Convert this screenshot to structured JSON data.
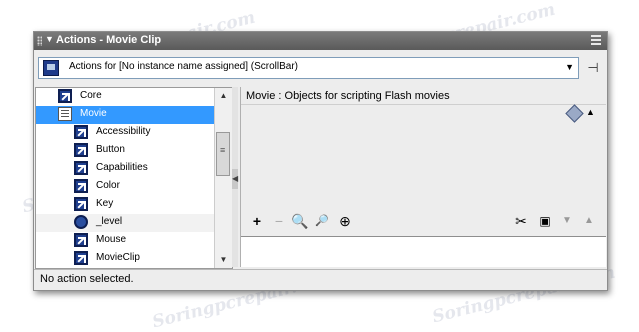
{
  "panel": {
    "title": "Actions - Movie Clip"
  },
  "target": {
    "text": "Actions for [No instance name assigned]  (ScrollBar)"
  },
  "toolbox": {
    "items": [
      {
        "label": "Core",
        "icon": "book-arrow-icon",
        "indent": 0
      },
      {
        "label": "Movie",
        "icon": "document-icon",
        "indent": 0,
        "selected": true
      },
      {
        "label": "Accessibility",
        "icon": "book-arrow-icon",
        "indent": 1
      },
      {
        "label": "Button",
        "icon": "book-arrow-icon",
        "indent": 1
      },
      {
        "label": "Capabilities",
        "icon": "book-arrow-icon",
        "indent": 1
      },
      {
        "label": "Color",
        "icon": "book-arrow-icon",
        "indent": 1
      },
      {
        "label": "Key",
        "icon": "book-arrow-icon",
        "indent": 1
      },
      {
        "label": "_level",
        "icon": "circle-arrow-icon",
        "indent": 1
      },
      {
        "label": "Mouse",
        "icon": "book-arrow-icon",
        "indent": 1
      },
      {
        "label": "MovieClip",
        "icon": "book-arrow-icon",
        "indent": 1
      }
    ]
  },
  "reference": {
    "title": "Movie : Objects for scripting Flash movies"
  },
  "status": {
    "text": "No action selected."
  },
  "watermark": "Soringpcrepair.com",
  "colors": {
    "title_bar": "#6a6a6a",
    "selection": "#3399ff",
    "panel_bg": "#ededed"
  }
}
